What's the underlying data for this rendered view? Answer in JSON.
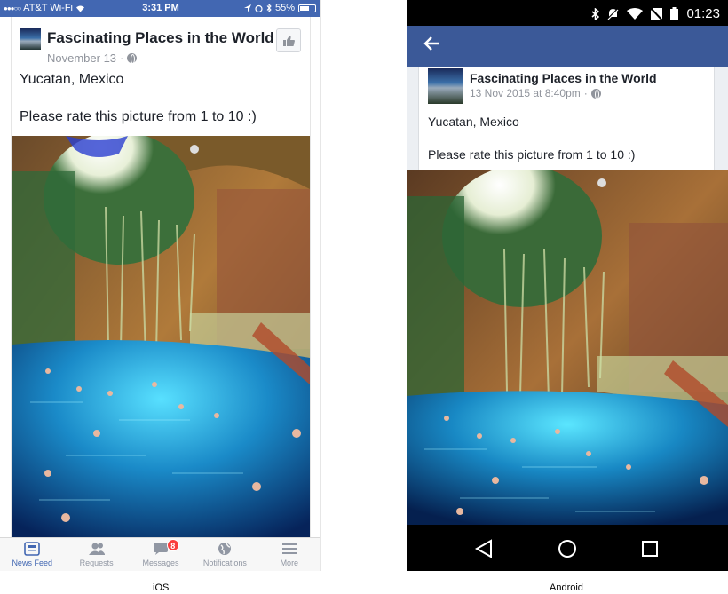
{
  "ios": {
    "caption": "iOS",
    "status": {
      "carrier": "AT&T Wi-Fi",
      "time": "3:31 PM",
      "battery": "55%"
    },
    "post": {
      "page_name": "Fascinating Places in the World",
      "date": "November 13",
      "privacy_separator": "·",
      "line1": "Yucatan, Mexico",
      "line2": "Please rate this picture from 1 to 10 :)"
    },
    "tabs": [
      {
        "label": "News Feed",
        "icon": "news-feed-icon",
        "active": true
      },
      {
        "label": "Requests",
        "icon": "friend-requests-icon",
        "active": false
      },
      {
        "label": "Messages",
        "icon": "messages-icon",
        "active": false,
        "badge": "8"
      },
      {
        "label": "Notifications",
        "icon": "globe-icon",
        "active": false
      },
      {
        "label": "More",
        "icon": "menu-icon",
        "active": false
      }
    ]
  },
  "android": {
    "caption": "Android",
    "status": {
      "time": "01:23"
    },
    "post": {
      "page_name": "Fascinating Places in the World",
      "date": "13 Nov 2015 at 8:40pm",
      "privacy_separator": "·",
      "line1": "Yucatan, Mexico",
      "line2": "Please rate this picture from 1 to 10 :)"
    },
    "nav": [
      "back-icon",
      "home-icon",
      "recents-icon"
    ]
  },
  "colors": {
    "facebook_blue_ios": "#4267b2",
    "facebook_blue_android": "#3b5998",
    "badge_red": "#fa3e3e",
    "secondary_text": "#90949c"
  }
}
